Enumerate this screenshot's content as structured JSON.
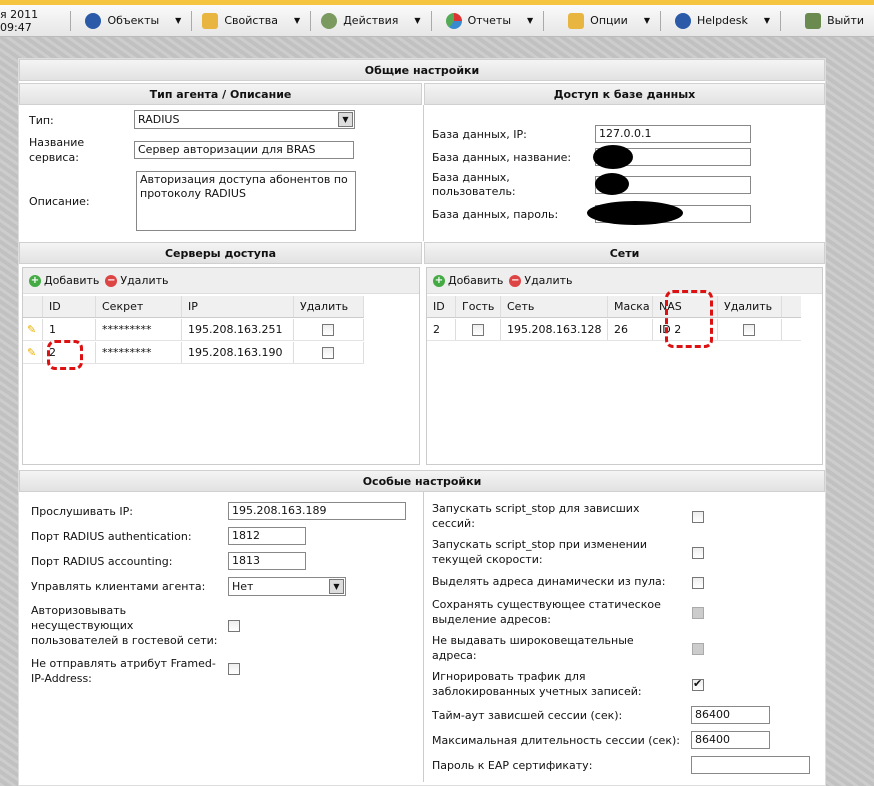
{
  "toolbar": {
    "datetime": "я 2011 09:47",
    "items": [
      {
        "label": "Объекты",
        "icon": "objects-icon",
        "color": "#2a5aa8"
      },
      {
        "label": "Свойства",
        "icon": "properties-icon",
        "color": "#e8b640"
      },
      {
        "label": "Действия",
        "icon": "actions-icon",
        "color": "#5a9a40"
      },
      {
        "label": "Отчеты",
        "icon": "reports-icon",
        "color": "#3a8ad0"
      },
      {
        "label": "Опции",
        "icon": "options-icon",
        "color": "#e8b640"
      },
      {
        "label": "Helpdesk",
        "icon": "help-icon",
        "color": "#2a5aa8"
      }
    ],
    "logout": "Выйти"
  },
  "general": {
    "title": "Общие настройки",
    "agent": {
      "title": "Тип агента / Описание",
      "type_label": "Тип:",
      "type_value": "RADIUS",
      "name_label1": "Название",
      "name_label2": "сервиса:",
      "name_value": "Сервер авторизации для BRAS",
      "desc_label": "Описание:",
      "desc_value": "Авторизация доступа абонентов по протоколу RADIUS"
    },
    "db": {
      "title": "Доступ к базе данных",
      "ip_label": "База данных, IP:",
      "ip_value": "127.0.0.1",
      "name_label": "База данных, название:",
      "user_label1": "База данных,",
      "user_label2": "пользователь:",
      "pass_label": "База данных, пароль:"
    }
  },
  "servers": {
    "title": "Серверы доступа",
    "add": "Добавить",
    "delete": "Удалить",
    "columns": [
      "ID",
      "Секрет",
      "IP",
      "Удалить"
    ],
    "rows": [
      {
        "id": "1",
        "secret": "*********",
        "ip": "195.208.163.251"
      },
      {
        "id": "2",
        "secret": "*********",
        "ip": "195.208.163.190"
      }
    ]
  },
  "networks": {
    "title": "Сети",
    "add": "Добавить",
    "delete": "Удалить",
    "columns": [
      "ID",
      "Гость",
      "Сеть",
      "Маска",
      "NAS",
      "Удалить"
    ],
    "rows": [
      {
        "id": "2",
        "net": "195.208.163.128",
        "mask": "26",
        "nas": "ID 2"
      }
    ]
  },
  "special": {
    "title": "Особые настройки",
    "listen_label": "Прослушивать IP:",
    "listen_value": "195.208.163.189",
    "auth_label": "Порт RADIUS authentication:",
    "auth_value": "1812",
    "acct_label": "Порт RADIUS accounting:",
    "acct_value": "1813",
    "manage_label": "Управлять клиентами агента:",
    "manage_value": "Нет",
    "guest_label": [
      "Авторизовывать",
      "несуществующих",
      "пользователей в гостевой сети:"
    ],
    "framed_label": [
      "Не отправлять атрибут Framed-",
      "IP-Address:"
    ],
    "right": [
      {
        "lines": [
          "Запускать script_stop для зависших",
          "сессий:"
        ],
        "state": "off"
      },
      {
        "lines": [
          "Запускать script_stop при изменении",
          "текущей скорости:"
        ],
        "state": "off"
      },
      {
        "lines": [
          "Выделять адреса динамически из пула:"
        ],
        "state": "off"
      },
      {
        "lines": [
          "Сохранять существующее статическое",
          "выделение адресов:"
        ],
        "state": "dis"
      },
      {
        "lines": [
          "Не выдавать широковещательные",
          "адреса:"
        ],
        "state": "dis"
      },
      {
        "lines": [
          "Игнорировать трафик для",
          "заблокированных учетных записей:"
        ],
        "state": "on"
      }
    ],
    "timeout_label": "Тайм-аут зависшей сессии (сек):",
    "timeout_value": "86400",
    "maxlen_label": "Максимальная длительность сессии (сек):",
    "maxlen_value": "86400",
    "eap_label": "Пароль к EAP сертификату:",
    "eap_value": ""
  }
}
